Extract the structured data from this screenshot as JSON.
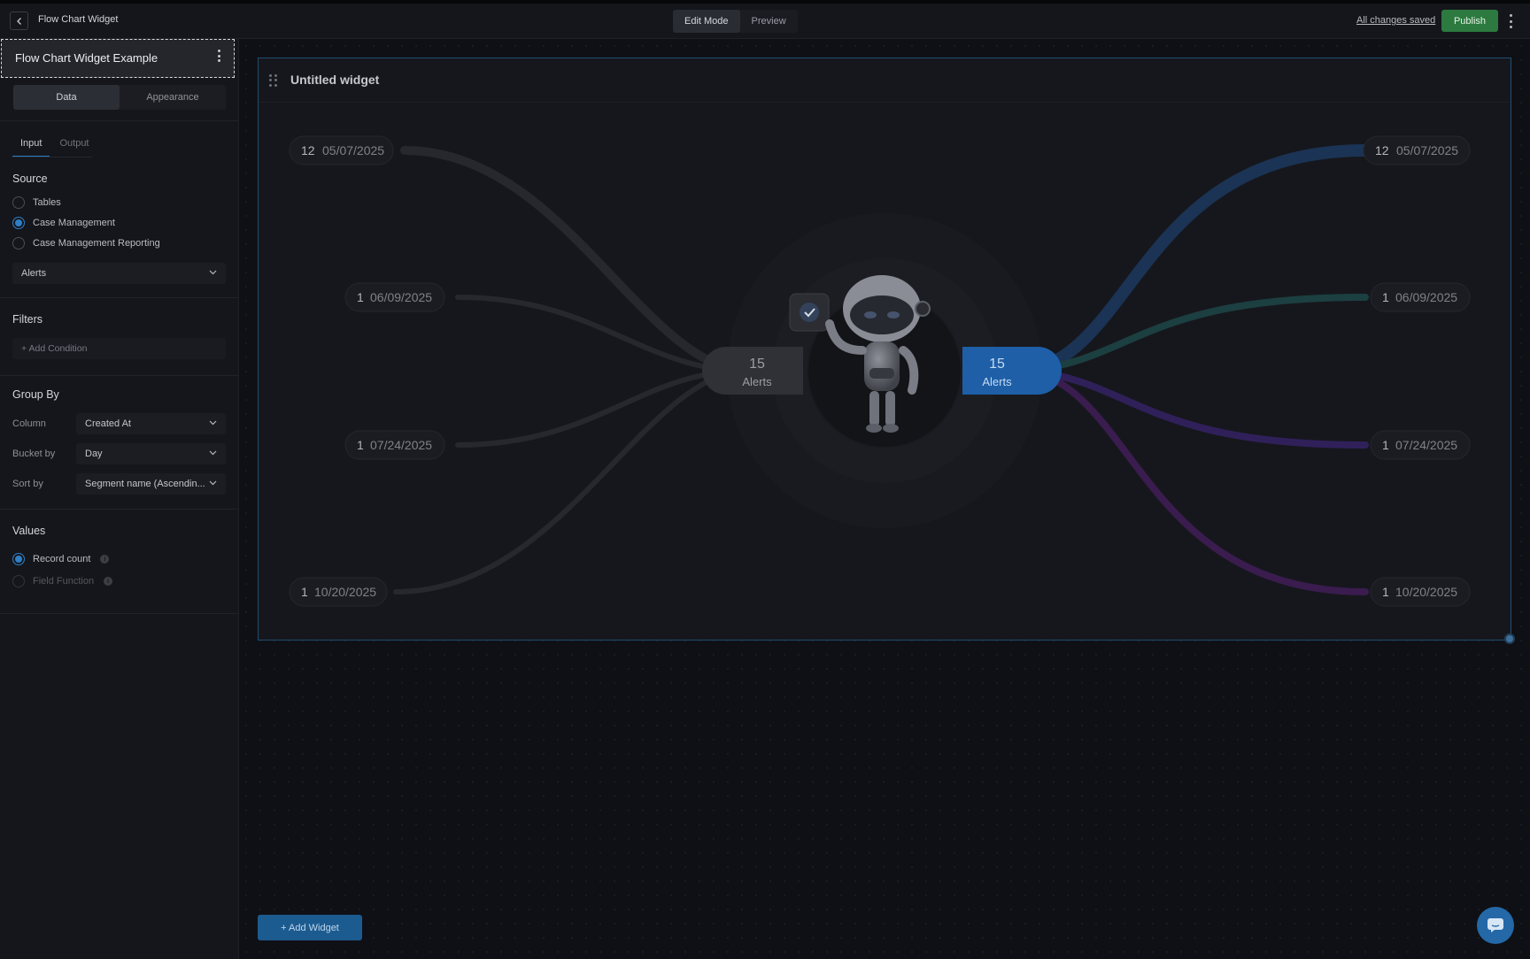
{
  "topbar": {
    "title": "Flow Chart Widget",
    "modes": [
      "Edit Mode",
      "Preview"
    ],
    "active_mode": "Edit Mode",
    "save_status": "All changes saved",
    "publish_label": "Publish"
  },
  "sidebar": {
    "widget_name": "Flow Chart Widget Example",
    "tabs": [
      "Data",
      "Appearance"
    ],
    "active_tab": "Data",
    "io_tabs": [
      "Input",
      "Output"
    ],
    "active_io_tab": "Input",
    "source": {
      "title": "Source",
      "options": [
        "Tables",
        "Case Management",
        "Case Management Reporting"
      ],
      "selected": "Case Management",
      "dataset": "Alerts"
    },
    "filters": {
      "title": "Filters",
      "add_condition": "+ Add Condition"
    },
    "group_by": {
      "title": "Group By",
      "column_label": "Column",
      "column_value": "Created At",
      "bucket_label": "Bucket by",
      "bucket_value": "Day",
      "sort_label": "Sort by",
      "sort_value": "Segment name (Ascendin..."
    },
    "values": {
      "title": "Values",
      "options": [
        "Record count",
        "Field Function"
      ],
      "selected": "Record count"
    }
  },
  "widget": {
    "title": "Untitled widget",
    "center_left": {
      "count": "15",
      "label": "Alerts"
    },
    "center_right": {
      "count": "15",
      "label": "Alerts"
    },
    "left_nodes": [
      {
        "count": "12",
        "date": "05/07/2025"
      },
      {
        "count": "1",
        "date": "06/09/2025"
      },
      {
        "count": "1",
        "date": "07/24/2025"
      },
      {
        "count": "1",
        "date": "10/20/2025"
      }
    ],
    "right_nodes": [
      {
        "count": "12",
        "date": "05/07/2025",
        "color": "#1e3a66"
      },
      {
        "count": "1",
        "date": "06/09/2025",
        "color": "#1c4a4a"
      },
      {
        "count": "1",
        "date": "07/24/2025",
        "color": "#3a2566"
      },
      {
        "count": "1",
        "date": "10/20/2025",
        "color": "#4a1f5e"
      }
    ],
    "accent_color": "#1e5fa8"
  },
  "footer": {
    "add_widget_label": "+ Add Widget"
  }
}
